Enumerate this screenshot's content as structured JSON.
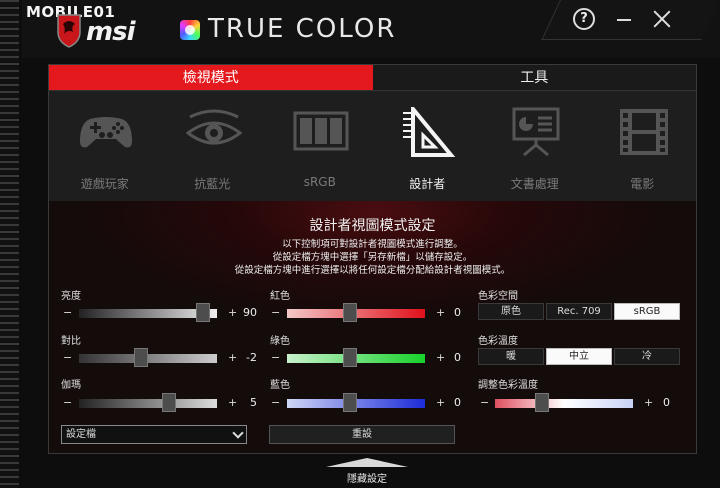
{
  "watermark": "MOBILE01",
  "brand": "msi",
  "app_title": "TRUE COLOR",
  "window": {
    "help": "?"
  },
  "tabs": [
    {
      "label": "檢視模式",
      "active": true
    },
    {
      "label": "工具",
      "active": false
    }
  ],
  "modes": [
    {
      "label": "遊戲玩家",
      "icon": "gamepad-icon",
      "active": false
    },
    {
      "label": "抗藍光",
      "icon": "eye-icon",
      "active": false
    },
    {
      "label": "sRGB",
      "icon": "srgb-panel-icon",
      "active": false
    },
    {
      "label": "設計者",
      "icon": "designer-ruler-icon",
      "active": true
    },
    {
      "label": "文書處理",
      "icon": "presentation-board-icon",
      "active": false
    },
    {
      "label": "電影",
      "icon": "film-strip-icon",
      "active": false
    }
  ],
  "settings": {
    "title": "設計者視圖模式設定",
    "desc": [
      "以下控制項可對設計者視圖模式進行調整。",
      "從設定檔方塊中選擇「另存新檔」以儲存設定。",
      "從設定檔方塊中進行選擇以將任何設定檔分配給設計者視圖模式。"
    ],
    "sliders": {
      "brightness": {
        "label": "亮度",
        "value": "90",
        "level": 0.9
      },
      "contrast": {
        "label": "對比",
        "value": "-2",
        "level": 0.45
      },
      "gamma": {
        "label": "伽瑪",
        "value": "5",
        "level": 0.65
      },
      "red": {
        "label": "紅色",
        "value": "0",
        "level": 0.46
      },
      "green": {
        "label": "綠色",
        "value": "0",
        "level": 0.46
      },
      "blue": {
        "label": "藍色",
        "value": "0",
        "level": 0.46
      },
      "temp_adjust": {
        "label": "調整色彩溫度",
        "value": "0",
        "level": 0.34
      }
    },
    "minus": "−",
    "plus": "+",
    "color_space": {
      "label": "色彩空間",
      "options": [
        "原色",
        "Rec. 709",
        "sRGB"
      ],
      "selected": "sRGB"
    },
    "color_temp": {
      "label": "色彩溫度",
      "options": [
        "暖",
        "中立",
        "冷"
      ],
      "selected": "中立"
    },
    "profile_dropdown": "設定檔",
    "reset_button": "重設"
  },
  "hide_settings": "隱藏設定",
  "colors": {
    "accent": "#e3191e"
  }
}
